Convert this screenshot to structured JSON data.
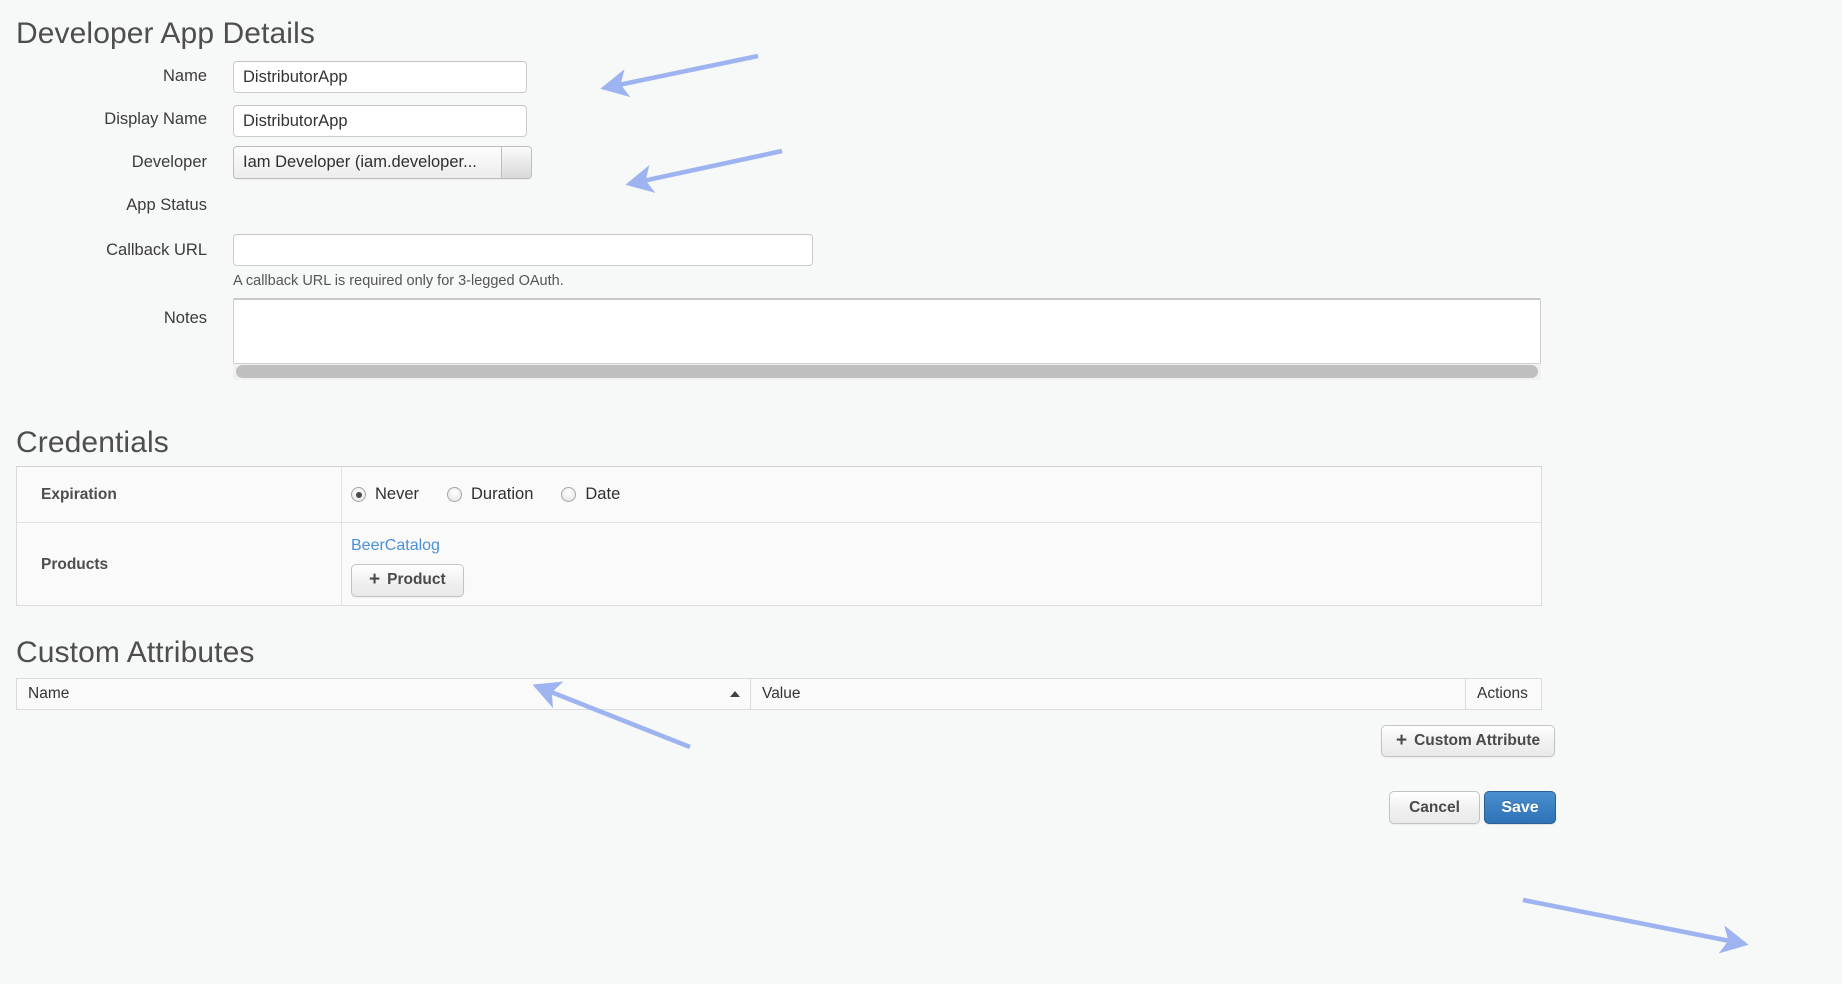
{
  "sections": {
    "app_details_title": "Developer App Details",
    "credentials_title": "Credentials",
    "custom_attributes_title": "Custom Attributes"
  },
  "form": {
    "name": {
      "label": "Name",
      "value": "DistributorApp",
      "placeholder": ""
    },
    "display_name": {
      "label": "Display Name",
      "value": "DistributorApp",
      "placeholder": ""
    },
    "developer": {
      "label": "Developer",
      "value": "Iam Developer (iam.developer...",
      "dropdown_icon": "dropdown-arrow-icon"
    },
    "app_status": {
      "label": "App Status",
      "value": ""
    },
    "callback_url": {
      "label": "Callback URL",
      "value": "",
      "placeholder": "",
      "hint": "A callback URL is required only for 3-legged OAuth."
    },
    "notes": {
      "label": "Notes",
      "value": "",
      "placeholder": ""
    }
  },
  "credentials": {
    "expiration": {
      "label": "Expiration",
      "options": [
        {
          "label": "Never",
          "selected": true
        },
        {
          "label": "Duration",
          "selected": false
        },
        {
          "label": "Date",
          "selected": false
        }
      ]
    },
    "products": {
      "label": "Products",
      "items": [
        "BeerCatalog"
      ],
      "add_button": {
        "label": "Product",
        "plus": "+"
      }
    }
  },
  "custom_attributes": {
    "columns": [
      "Name",
      "Value",
      "Actions"
    ],
    "rows": [],
    "sort_column": "Name",
    "sort_direction": "asc",
    "add_button": {
      "label": "Custom Attribute",
      "plus": "+"
    }
  },
  "footer": {
    "cancel_label": "Cancel",
    "save_label": "Save"
  },
  "colors": {
    "page_bg": "#f7f8f8",
    "link": "#4a90d9",
    "save_button": "#2f72b8",
    "annotation_arrow": "#9db4f0",
    "heading_text": "#4e4e4e"
  },
  "annotations": [
    {
      "name": "arrow-to-name-field",
      "target": "name-input"
    },
    {
      "name": "arrow-to-developer-dropdown",
      "target": "developer-dropdown"
    },
    {
      "name": "arrow-to-add-product-button",
      "target": "add-product-button"
    },
    {
      "name": "arrow-to-save-button",
      "target": "save-button"
    }
  ]
}
